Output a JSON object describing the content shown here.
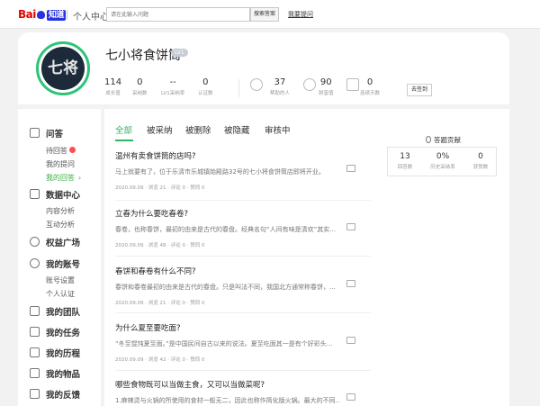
{
  "header": {
    "logo_text": "Bai",
    "logo_text2": "百度",
    "logo_zhidao": "知道",
    "title": "个人中心",
    "search_placeholder": "请在此输入问题",
    "search_button": "搜索答案",
    "my_link": "我要提问"
  },
  "profile": {
    "username": "七小将食饼筒",
    "level": "LV1",
    "avatar_text": "七将",
    "stats": [
      {
        "num": "114",
        "label": "成长值"
      },
      {
        "num": "0",
        "label": "采纳数"
      },
      {
        "num": "--",
        "label": "LV1采纳率"
      },
      {
        "num": "0",
        "label": "认证数"
      }
    ],
    "stats2": [
      {
        "num": "37",
        "label": "帮助的人"
      },
      {
        "num": "90",
        "label": "财富值"
      },
      {
        "num": "0",
        "label": "连续天数"
      }
    ],
    "checkin": "去签到"
  },
  "sidebar": {
    "sections": [
      {
        "head": "问答",
        "icon": "question-icon",
        "subs": [
          {
            "label": "待回答",
            "badge": true
          },
          {
            "label": "我的提问"
          },
          {
            "label": "我的回答",
            "active": true
          }
        ]
      },
      {
        "head": "数据中心",
        "icon": "chart-icon",
        "subs": [
          {
            "label": "内容分析"
          },
          {
            "label": "互动分析"
          }
        ]
      },
      {
        "head": "权益广场",
        "icon": "gift-icon",
        "subs": []
      },
      {
        "head": "我的账号",
        "icon": "user-icon",
        "subs": [
          {
            "label": "账号设置"
          },
          {
            "label": "个人认证"
          }
        ]
      },
      {
        "head": "我的团队",
        "icon": "team-icon",
        "subs": []
      },
      {
        "head": "我的任务",
        "icon": "task-icon",
        "subs": []
      },
      {
        "head": "我的历程",
        "icon": "history-icon",
        "subs": []
      },
      {
        "head": "我的物品",
        "icon": "items-icon",
        "subs": []
      },
      {
        "head": "我的反馈",
        "icon": "feedback-icon",
        "subs": []
      }
    ]
  },
  "tabs": [
    "全部",
    "被采纳",
    "被删除",
    "被隐藏",
    "审核中"
  ],
  "questions": [
    {
      "title": "温州有卖食饼筒的店吗?",
      "excerpt": "马上就要有了，位于乐清市乐城镇始殿路32号的七小将食饼筒店即将开业。",
      "meta": "2020.09.09 · 浏览 21 · 评论 0 · 赞同 0"
    },
    {
      "title": "立春为什么要吃春卷?",
      "excerpt": "春卷，也称春饼，最初的由来是古代的春盘。经典名句“人间有味是清欢”其实...",
      "meta": "2020.09.09 · 浏览 48 · 评论 0 · 赞同 0"
    },
    {
      "title": "春饼和春卷有什么不同?",
      "excerpt": "春饼和春卷最初的由来是古代的春盘。只是叫法不同，我国北方通常称春饼，...",
      "meta": "2020.09.09 · 浏览 21 · 评论 0 · 赞同 0"
    },
    {
      "title": "为什么夏至要吃面?",
      "excerpt": "“冬至馄饨夏至面。”是中国民间自古以来的说法。夏至吃面其一是有个好彩头...",
      "meta": "2020.09.09 · 浏览 42 · 评论 0 · 赞同 0"
    },
    {
      "title": "哪些食物既可以当做主食，又可以当做菜呢?",
      "excerpt": "1.麻辣烫与火锅的所使用的食材一般无二，因此也称作简化版火锅。最大的不同...",
      "meta": ""
    }
  ],
  "contribution": {
    "title": "答题贡献",
    "stats": [
      {
        "num": "13",
        "label": "回答数"
      },
      {
        "num": "0%",
        "label": "历史采纳率"
      },
      {
        "num": "0",
        "label": "获赞数"
      }
    ]
  },
  "colors": {
    "accent_green": "#2eb562",
    "brand_blue": "#2932e1",
    "brand_red": "#e10602"
  }
}
